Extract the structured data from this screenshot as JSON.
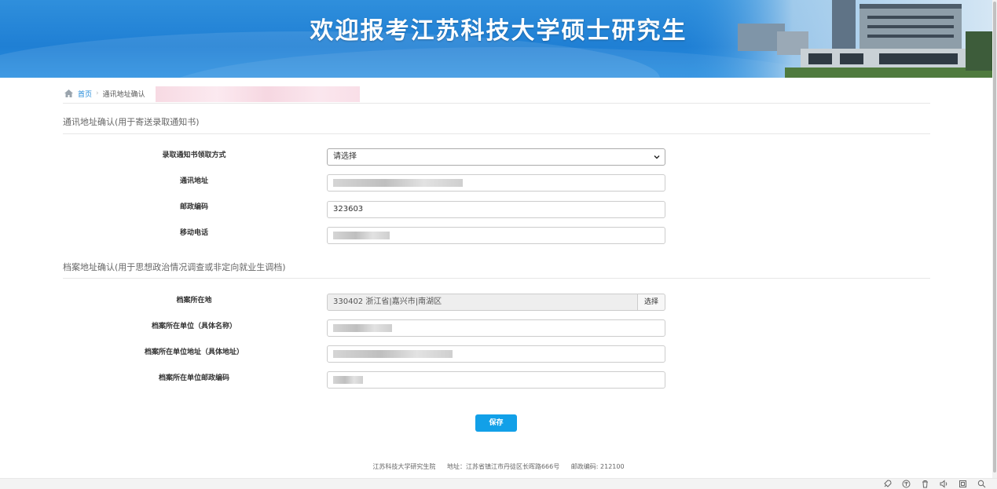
{
  "banner": {
    "title": "欢迎报考江苏科技大学硕士研究生"
  },
  "breadcrumb": {
    "home": "首页",
    "current": "通讯地址确认"
  },
  "section1": {
    "title": "通讯地址确认(用于寄送录取通知书)",
    "fields": {
      "pickup_label": "录取通知书领取方式",
      "pickup_value": "请选择",
      "address_label": "通讯地址",
      "zip_label": "邮政编码",
      "zip_value": "323603",
      "phone_label": "移动电话"
    }
  },
  "section2": {
    "title": "档案地址确认(用于思想政治情况调查或非定向就业生调档)",
    "fields": {
      "location_label": "档案所在地",
      "location_value": "330402 浙江省|嘉兴市|南湖区",
      "choose_label": "选择",
      "unit_name_label": "档案所在单位（具体名称）",
      "unit_addr_label": "档案所在单位地址（具体地址）",
      "unit_zip_label": "档案所在单位邮政编码"
    }
  },
  "save_label": "保存",
  "footer": {
    "school": "江苏科技大学研究生院",
    "address": "地址：江苏省镇江市丹徒区长晖路666号",
    "zip": "邮政编码: 212100"
  },
  "colors": {
    "accent": "#12a0e8",
    "banner": "#1f7fd4",
    "link": "#1e88d9"
  }
}
